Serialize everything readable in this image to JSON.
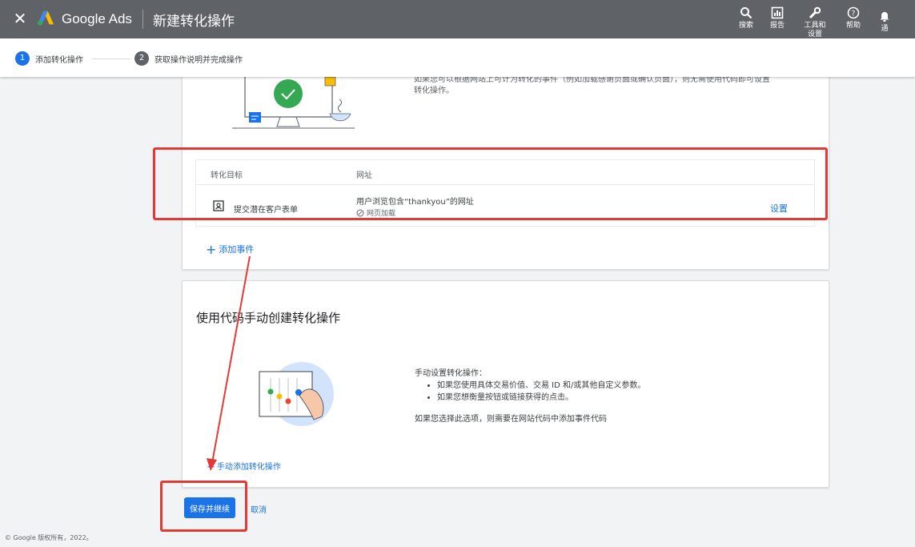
{
  "topbar": {
    "brand": "Google Ads",
    "page_title": "新建转化操作",
    "tools": [
      {
        "label": "搜索",
        "icon": "search-icon"
      },
      {
        "label": "报告",
        "icon": "reports-icon"
      },
      {
        "label": "工具和\n设置",
        "icon": "wrench-icon"
      },
      {
        "label": "帮助",
        "icon": "help-icon"
      },
      {
        "label": "通",
        "icon": "bell-icon"
      }
    ]
  },
  "stepper": {
    "steps": [
      {
        "number": "1",
        "label": "添加转化操作",
        "active": true
      },
      {
        "number": "2",
        "label": "获取操作说明并完成操作",
        "active": false
      }
    ]
  },
  "website_card": {
    "description": "如果您可以根据网站上可计为转化的事件（例如加载感谢页面或确认页面），则无需使用代码即可设置转化操作。",
    "table": {
      "headers": [
        "转化目标",
        "网址"
      ],
      "rows": [
        {
          "goal": "提交潜在客户表单",
          "url": "用户浏览包含“thankyou”的网址",
          "trigger": "网页加载",
          "action": "设置"
        }
      ]
    },
    "add_event": "添加事件"
  },
  "manual_card": {
    "title": "使用代码手动创建转化操作",
    "intro": "手动设置转化操作：",
    "bullets": [
      "如果您使用具体交易价值、交易 ID 和/或其他自定义参数。",
      "如果您想衡量按钮或链接获得的点击。"
    ],
    "note": "如果您选择此选项，则需要在网站代码中添加事件代码",
    "add_manual": "手动添加转化操作"
  },
  "actions": {
    "save": "保存并继续",
    "cancel": "取消"
  },
  "footer": "© Google 版权所有，2022。",
  "colors": {
    "topbar": "#5f6368",
    "accent": "#1a73e8",
    "annotation": "#e53935",
    "check_green": "#34a853"
  }
}
